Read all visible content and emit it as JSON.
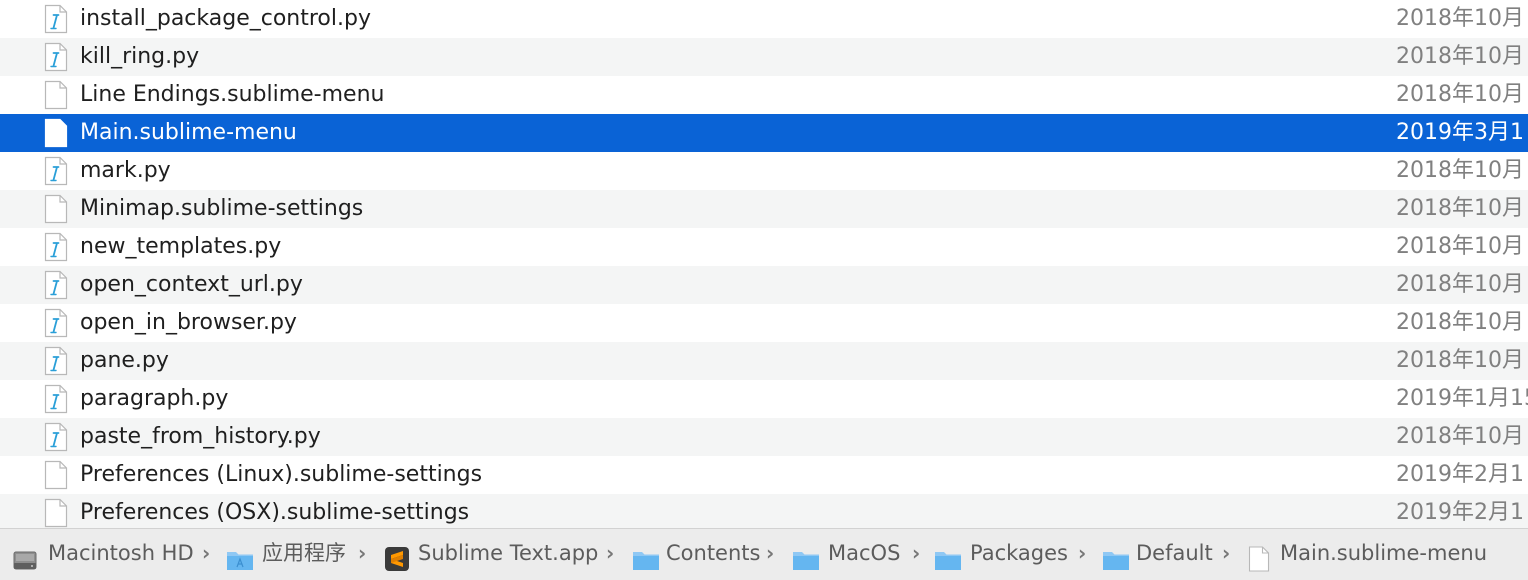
{
  "files": [
    {
      "name": "install_package_control.py",
      "date": "2018年10月",
      "kind": "py",
      "selected": false
    },
    {
      "name": "kill_ring.py",
      "date": "2018年10月",
      "kind": "py",
      "selected": false
    },
    {
      "name": "Line Endings.sublime-menu",
      "date": "2018年10月",
      "kind": "doc",
      "selected": false
    },
    {
      "name": "Main.sublime-menu",
      "date": "2019年3月1",
      "kind": "doc",
      "selected": true
    },
    {
      "name": "mark.py",
      "date": "2018年10月",
      "kind": "py",
      "selected": false
    },
    {
      "name": "Minimap.sublime-settings",
      "date": "2018年10月",
      "kind": "doc",
      "selected": false
    },
    {
      "name": "new_templates.py",
      "date": "2018年10月",
      "kind": "py",
      "selected": false
    },
    {
      "name": "open_context_url.py",
      "date": "2018年10月",
      "kind": "py",
      "selected": false
    },
    {
      "name": "open_in_browser.py",
      "date": "2018年10月",
      "kind": "py",
      "selected": false
    },
    {
      "name": "pane.py",
      "date": "2018年10月",
      "kind": "py",
      "selected": false
    },
    {
      "name": "paragraph.py",
      "date": "2019年1月15",
      "kind": "py",
      "selected": false
    },
    {
      "name": "paste_from_history.py",
      "date": "2018年10月",
      "kind": "py",
      "selected": false
    },
    {
      "name": "Preferences (Linux).sublime-settings",
      "date": "2019年2月1",
      "kind": "doc",
      "selected": false
    },
    {
      "name": "Preferences (OSX).sublime-settings",
      "date": "2019年2月1",
      "kind": "doc",
      "selected": false
    }
  ],
  "path_bar": {
    "items": [
      {
        "label": "Macintosh HD",
        "icon": "hard-drive-icon"
      },
      {
        "label": "应用程序",
        "icon": "applications-folder-icon"
      },
      {
        "label": "Sublime Text.app",
        "icon": "sublime-app-icon"
      },
      {
        "label": "Contents",
        "icon": "folder-icon"
      },
      {
        "label": "MacOS",
        "icon": "folder-icon"
      },
      {
        "label": "Packages",
        "icon": "folder-icon"
      },
      {
        "label": "Default",
        "icon": "folder-icon"
      },
      {
        "label": "Main.sublime-menu",
        "icon": "document-icon"
      }
    ],
    "separator": "›"
  },
  "colors": {
    "selection": "#0a63d6",
    "row_alt": "#f4f5f5",
    "folder": "#65b6f0",
    "python_mark": "#2a9fd8",
    "sublime_orange": "#ff9800"
  }
}
